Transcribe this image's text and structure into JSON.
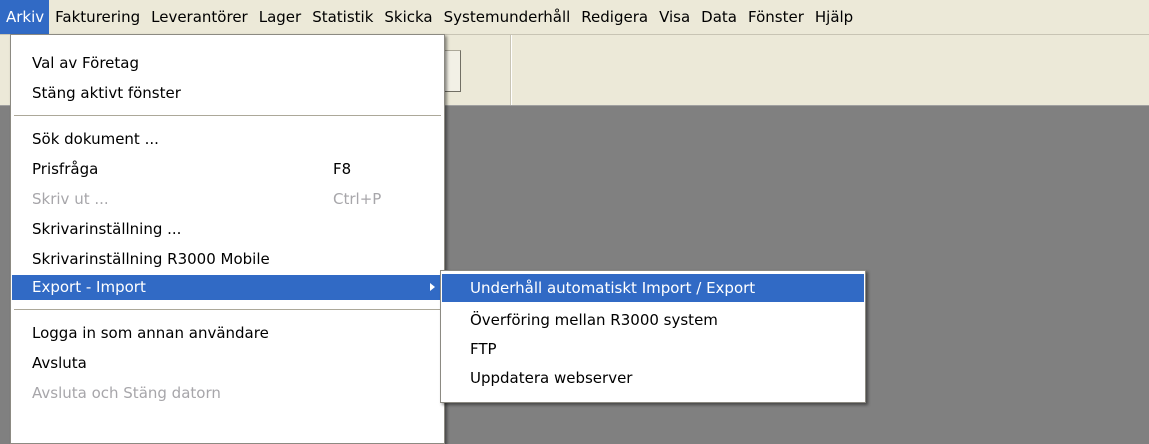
{
  "menubar": {
    "items": [
      "Arkiv",
      "Fakturering",
      "Leverantörer",
      "Lager",
      "Statistik",
      "Skicka",
      "Systemunderhåll",
      "Redigera",
      "Visa",
      "Data",
      "Fönster",
      "Hjälp"
    ]
  },
  "arkiv_menu": {
    "items": [
      {
        "label": "Val av Företag",
        "shortcut": "",
        "disabled": false
      },
      {
        "label": "Stäng aktivt fönster",
        "shortcut": "",
        "disabled": false
      },
      {
        "label": "Sök dokument ...",
        "shortcut": "",
        "disabled": false
      },
      {
        "label": "Prisfråga",
        "shortcut": "F8",
        "disabled": false
      },
      {
        "label": "Skriv ut ...",
        "shortcut": "Ctrl+P",
        "disabled": true
      },
      {
        "label": "Skrivarinställning ...",
        "shortcut": "",
        "disabled": false
      },
      {
        "label": "Skrivarinställning R3000 Mobile",
        "shortcut": "",
        "disabled": false
      },
      {
        "label": "Export - Import",
        "shortcut": "",
        "disabled": false,
        "highlighted": true,
        "submenu": true
      },
      {
        "label": "Logga in som annan användare",
        "shortcut": "",
        "disabled": false
      },
      {
        "label": "Avsluta",
        "shortcut": "",
        "disabled": false
      },
      {
        "label": "Avsluta och Stäng datorn",
        "shortcut": "",
        "disabled": true
      }
    ]
  },
  "export_submenu": {
    "items": [
      {
        "label": "Underhåll automatiskt Import / Export",
        "highlighted": true
      },
      {
        "label": "Överföring mellan R3000 system"
      },
      {
        "label": "FTP"
      },
      {
        "label": "Uppdatera webserver"
      }
    ]
  },
  "colors": {
    "highlight": "#316ac5",
    "menubar": "#ece9d8",
    "workspace": "#808080",
    "disabled_text": "#a7a6aa"
  }
}
